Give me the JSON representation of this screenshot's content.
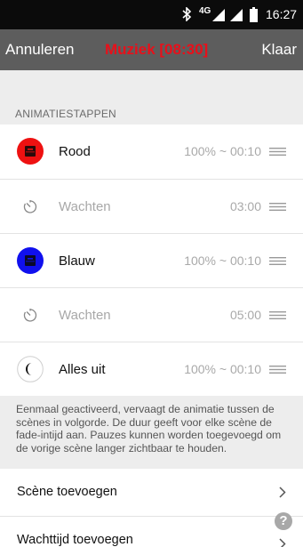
{
  "status_bar": {
    "network": "4G",
    "time": "16:27",
    "icons": [
      "bluetooth-icon",
      "signal-icon",
      "signal-icon",
      "battery-icon"
    ]
  },
  "nav": {
    "cancel_label": "Annuleren",
    "title": "Muziek [08:30]",
    "done_label": "Klaar"
  },
  "colors": {
    "nav_background": "#5d5d5d",
    "title_accent": "#e8101a",
    "red_scene": "#ee1111",
    "blue_scene": "#1010ee"
  },
  "section": {
    "header": "ANIMATIESTAPPEN"
  },
  "steps": [
    {
      "type": "scene",
      "icon": "red-scene-icon",
      "name": "Rood",
      "value": "100% ~ 00:10"
    },
    {
      "type": "wait",
      "icon": "timer-icon",
      "name": "Wachten",
      "value": "03:00"
    },
    {
      "type": "scene",
      "icon": "blue-scene-icon",
      "name": "Blauw",
      "value": "100% ~ 00:10"
    },
    {
      "type": "wait",
      "icon": "timer-icon",
      "name": "Wachten",
      "value": "05:00"
    },
    {
      "type": "scene",
      "icon": "moon-icon",
      "name": "Alles uit",
      "value": "100% ~ 00:10"
    }
  ],
  "info_text": "Eenmaal geactiveerd, vervaagt de animatie tussen de scènes in volgorde. De duur geeft voor elke scène de fade-intijd aan. Pauzes kunnen worden toegevoegd om de vorige scène langer zichtbaar te houden.",
  "actions": [
    {
      "label": "Scène toevoegen"
    },
    {
      "label": "Wachttijd toevoegen"
    }
  ],
  "help_glyph": "?"
}
